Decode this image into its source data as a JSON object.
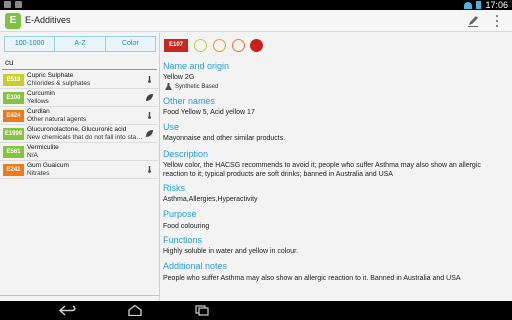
{
  "statusbar": {
    "time": "17:06"
  },
  "app": {
    "title": "E-Additives"
  },
  "filters": [
    "100-1000",
    "A-Z",
    "Color"
  ],
  "search": {
    "value": "cu"
  },
  "list": [
    {
      "code": "E519",
      "color": "yellow",
      "name": "Cupric Sulphate",
      "sub": "Chlorides & sulphates",
      "icon": "thermometer-icon"
    },
    {
      "code": "E100",
      "color": "green",
      "name": "Curcumin",
      "sub": "Yellows",
      "icon": "leaf-icon"
    },
    {
      "code": "E424",
      "color": "orange",
      "name": "Curdlan",
      "sub": "Other natural agents",
      "icon": "thermometer-icon"
    },
    {
      "code": "E1999",
      "color": "green",
      "name": "Glucuronolactone, Glucuronic acid",
      "sub": "New chemicals that do not fall into stan...",
      "icon": "leaf-icon"
    },
    {
      "code": "E561",
      "color": "green",
      "name": "Vermiculite",
      "sub": "N/A",
      "icon": ""
    },
    {
      "code": "E241",
      "color": "orange",
      "name": "Gum Guaicum",
      "sub": "Nitrates",
      "icon": "thermometer-icon"
    }
  ],
  "detail": {
    "code": "E107",
    "name_origin_title": "Name and origin",
    "name": "Yellow 2G",
    "origin": "Synthetic Based",
    "other_names_title": "Other names",
    "other_names": "Food Yellow 5, Acid yellow 17",
    "use_title": "Use",
    "use": "Mayonnaise and other similar products.",
    "description_title": "Description",
    "description": "Yellow color, the HACSG recommends to avoid it; people who suffer Asthma may also show an allergic reaction to it; typical products are soft drinks; banned in Australia and USA",
    "risks_title": "Risks",
    "risks": "Asthma,Allergies,Hyperactivity",
    "purpose_title": "Purpose",
    "purpose": "Food colouring",
    "functions_title": "Functions",
    "functions": "Highly soluble in water and yellow in colour.",
    "additional_title": "Additional notes",
    "additional": "People who suffer Asthma may also show an allergic reaction to it. Banned in Australia and USA"
  },
  "colors": {
    "accent": "#2a9fd6",
    "danger": "#c52a22",
    "app_green": "#7cc243"
  }
}
